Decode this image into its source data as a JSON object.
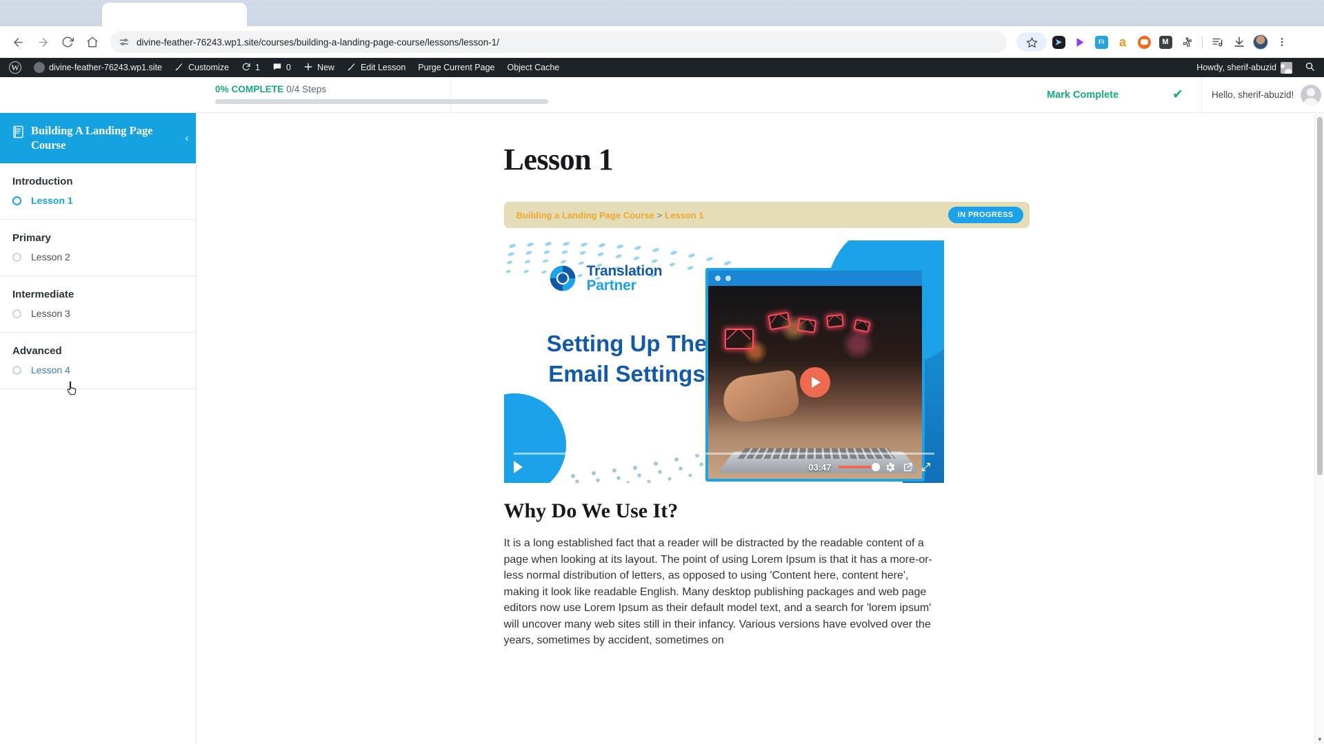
{
  "browser": {
    "tab_title": "",
    "url": "divine-feather-76243.wp1.site/courses/building-a-landing-page-course/lessons/lesson-1/",
    "nav": {
      "back": "Back",
      "forward": "Forward",
      "reload": "Reload",
      "home": "Home"
    },
    "extensions": [
      {
        "name": "cursor-extension-icon",
        "glyph": "➤",
        "bg": "#1f1f22",
        "fg": "#7fd1ff"
      },
      {
        "name": "purple-send-extension-icon",
        "glyph": "➤",
        "bg": "#ffffff",
        "fg": "#8b3dff"
      },
      {
        "name": "fi-extension-icon",
        "glyph": "FI",
        "bg": "#2aa3dd",
        "fg": "#ffffff"
      },
      {
        "name": "amazon-extension-icon",
        "glyph": "a",
        "bg": "#ffffff",
        "fg": "#f09418"
      },
      {
        "name": "bot-extension-icon",
        "glyph": "●",
        "bg": "#f26b21",
        "fg": "#ffffff"
      },
      {
        "name": "gmail-m-extension-icon",
        "glyph": "M",
        "bg": "#3c4043",
        "fg": "#ffffff"
      },
      {
        "name": "puzzle-extensions-icon",
        "glyph": "⬟",
        "bg": "#ffffff",
        "fg": "#5f6368"
      }
    ],
    "menu_tooltip": "Customize and control Google Chrome"
  },
  "adminbar": {
    "wp_logo": "W",
    "site_name": "divine-feather-76243.wp1.site",
    "customize": "Customize",
    "updates_count": "1",
    "comments_count": "0",
    "new": "New",
    "edit_lesson": "Edit Lesson",
    "purge_current_page": "Purge Current Page",
    "object_cache": "Object Cache",
    "howdy": "Howdy, sherif-abuzid",
    "search_label": "Search"
  },
  "ld_topbar": {
    "progress_percent_label": "0% COMPLETE",
    "steps_label": "0/4 Steps",
    "progress_value": 0,
    "mark_complete_label": "Mark Complete",
    "check_glyph": "✔",
    "greeting": "Hello, sherif-abuzid!"
  },
  "sidebar": {
    "course_title": "Building A Landing Page Course",
    "collapse_glyph": "‹",
    "sections": [
      {
        "title": "Introduction",
        "lessons": [
          {
            "label": "Lesson 1",
            "state": "active"
          }
        ]
      },
      {
        "title": "Primary",
        "lessons": [
          {
            "label": "Lesson 2",
            "state": "normal"
          }
        ]
      },
      {
        "title": "Intermediate",
        "lessons": [
          {
            "label": "Lesson 3",
            "state": "normal"
          }
        ]
      },
      {
        "title": "Advanced",
        "lessons": [
          {
            "label": "Lesson 4",
            "state": "linked"
          }
        ]
      }
    ]
  },
  "content": {
    "lesson_title": "Lesson 1",
    "breadcrumb": {
      "course": "Building a Landing Page Course",
      "separator": ">",
      "current": "Lesson 1"
    },
    "status_badge": "IN PROGRESS",
    "banner": {
      "logo_line1": "Translation",
      "logo_line2": "Partner",
      "heading": "Setting Up The Email Settings"
    },
    "video": {
      "time": "03:47",
      "play_label": "Play",
      "settings_label": "Settings",
      "popout_label": "Pop out",
      "fullscreen_label": "Fullscreen",
      "progress_percent": 0,
      "volume_percent": 100
    },
    "section_heading": "Why Do We Use It?",
    "paragraph": "It is a long established fact that a reader will be distracted by the readable content of a page when looking at its layout. The point of using Lorem Ipsum is that it has a more-or-less normal distribution of letters, as opposed to using 'Content here, content here', making it look like readable English. Many desktop publishing packages and web page editors now use Lorem Ipsum as their default model text, and a search for 'lorem ipsum' will uncover many web sites still in their infancy. Various versions have evolved over the years, sometimes by accident, sometimes on"
  },
  "colors": {
    "accent_blue": "#15a2e0",
    "progress_green": "#16a881",
    "breadcrumb_bg": "#e5dcb8",
    "breadcrumb_link": "#f0a92c",
    "admin_bar": "#1d2327",
    "brand_deep_blue": "#1259a8",
    "play_orange": "#ef6b4f"
  }
}
